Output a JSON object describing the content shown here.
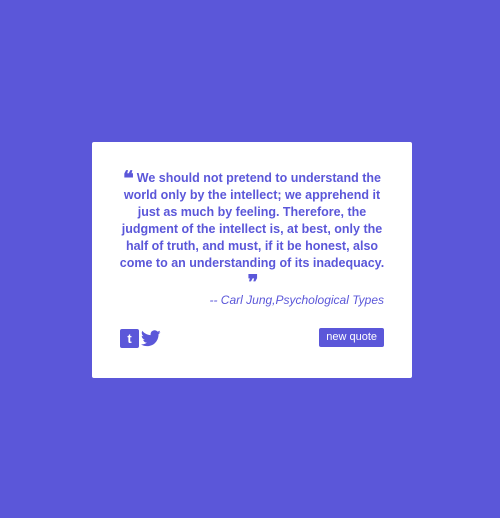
{
  "quote": {
    "open_mark": "❝",
    "text": "We should not pretend to understand the world only by the intellect; we apprehend it just as much by feeling. Therefore, the judgment of the intellect is, at best, only the half of truth, and must, if it be honest, also come to an understanding of its inadequacy.",
    "close_mark": "❞",
    "author": "-- Carl Jung,Psychological Types"
  },
  "actions": {
    "tumblr_icon_glyph": "t",
    "tumblr_icon": "tumblr-icon",
    "twitter_icon": "twitter-icon",
    "new_quote_label": "new quote"
  },
  "colors": {
    "background": "#5b57d9",
    "card": "#ffffff",
    "accent": "#5b57d9"
  }
}
